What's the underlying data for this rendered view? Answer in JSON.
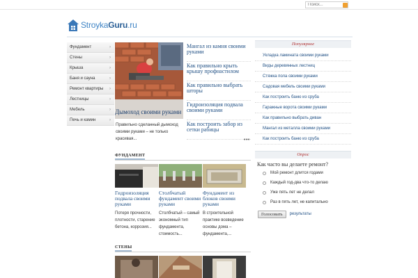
{
  "search": {
    "placeholder": "Поиск..."
  },
  "logo": {
    "part1": "Stroyka",
    "part2": "Guru",
    "part3": ".ru"
  },
  "sidebar": {
    "items": [
      {
        "label": "Фундамент"
      },
      {
        "label": "Стены"
      },
      {
        "label": "Крыша"
      },
      {
        "label": "Баня и сауна"
      },
      {
        "label": "Ремонт квартиры"
      },
      {
        "label": "Лестницы"
      },
      {
        "label": "Мебель"
      },
      {
        "label": "Печь и камин"
      }
    ],
    "arrow": "›"
  },
  "feature": {
    "title": "Дымоход своими руками",
    "desc": "Правильно сделанный дымоход своими руками – не только красивая..."
  },
  "mid_links": [
    "Мангал из камня своими руками",
    "Как правильно крыть крышу профнастилом",
    "Как правильно выбрать шторы",
    "Гидроизоляция подвала своими руками",
    "Как построить забор из сетки рабицы"
  ],
  "more": "•••",
  "sections": {
    "foundation": "ФУНДАМЕНТ",
    "walls": "СТЕНЫ"
  },
  "cards": [
    {
      "title": "Гидроизоляция подвала своими руками",
      "desc": "Потеря прочности, плотности, старение бетона, коррозия..."
    },
    {
      "title": "Столбчатый фундамент своими руками",
      "desc": "Столбчатый – самый экономный тип фундамента, стоимость..."
    },
    {
      "title": "Фундамент из блоков своими руками",
      "desc": "В строительной практике возведение основы дома – фундамента,..."
    }
  ],
  "popular": {
    "title": "Популярное",
    "items": [
      "Укладка ламината своими руками",
      "Виды деревянных лестниц",
      "Стяжка пола своими руками",
      "Садовая мебель своими руками",
      "Как построить баню из сруба",
      "Гаражные ворота своими руками",
      "Как правильно выбрать диван",
      "Мангал из металла своими руками",
      "Как построить баню из сруба"
    ]
  },
  "poll": {
    "title": "Опрос",
    "question": "Как часто вы делаете ремонт?",
    "options": [
      "Мой ремонт длится годами",
      "Каждый год-два что-то делаю",
      "Уже пять лет не делал",
      "Раз в пять лет, не капитально"
    ],
    "vote_label": "Голосовать",
    "results_label": "результаты"
  },
  "colors": {
    "link": "#1f4f84",
    "accent": "#b03030",
    "search_button": "#f0a030"
  }
}
